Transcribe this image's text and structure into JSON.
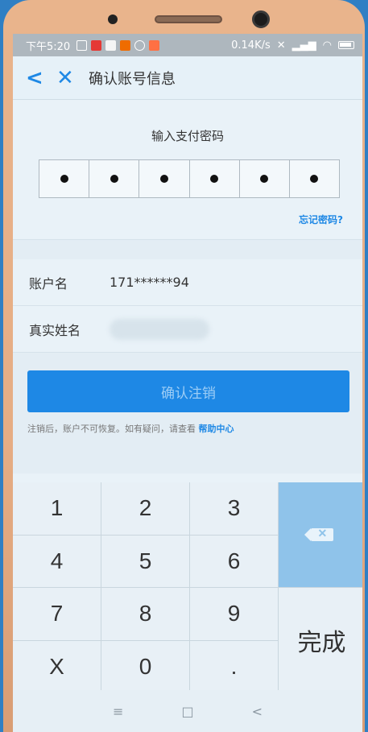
{
  "status": {
    "time": "下午5:20",
    "speed": "0.14K/s"
  },
  "nav": {
    "title": "确认账号信息"
  },
  "password": {
    "title": "输入支付密码",
    "digits_filled": 6,
    "forgot": "忘记密码?"
  },
  "account": {
    "name_label": "账户名",
    "name_value": "171******94",
    "real_name_label": "真实姓名"
  },
  "confirm": {
    "button": "确认注销",
    "note_prefix": "注销后，账户不可恢复。如有疑问，请查看",
    "note_link": "帮助中心"
  },
  "keypad": {
    "keys": [
      "1",
      "2",
      "3",
      "4",
      "5",
      "6",
      "7",
      "8",
      "9",
      "X",
      "0",
      "."
    ],
    "done": "完成"
  },
  "colors": {
    "accent": "#1e88e5"
  }
}
